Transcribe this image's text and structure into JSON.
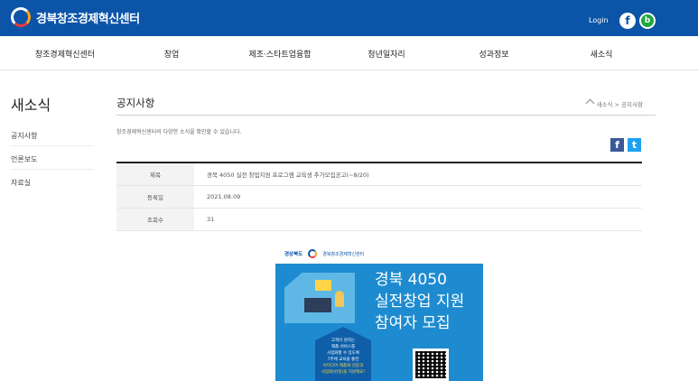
{
  "header": {
    "logo_text": "경북창조경제혁신센터",
    "login_label": "Login",
    "facebook_glyph": "f",
    "band_glyph": "b"
  },
  "nav": {
    "items": [
      {
        "label": "창조경제혁신센터"
      },
      {
        "label": "창업"
      },
      {
        "label": "제조·스타트업융합"
      },
      {
        "label": "청년일자리"
      },
      {
        "label": "성과정보"
      },
      {
        "label": "새소식"
      }
    ]
  },
  "sidebar": {
    "title": "새소식",
    "items": [
      {
        "label": "공지사항"
      },
      {
        "label": "언론보도"
      },
      {
        "label": "자료실"
      }
    ]
  },
  "main": {
    "title": "공지사항",
    "breadcrumb": "새소식 > 공지사항",
    "description": "창조경제혁신센터의 다양한 소식을 확인할 수 있습니다.",
    "share": {
      "facebook": "f",
      "twitter": "t"
    },
    "info": {
      "subject_key": "제목",
      "subject_value": "경북 4050 실전 창업지원 프로그램 교육생 추가모집공고(~8/20)",
      "date_key": "등록일",
      "date_value": "2021.08.09",
      "views_key": "조회수",
      "views_value": "31"
    },
    "poster": {
      "org1": "경상북도",
      "org2": "경북창조경제혁신센터",
      "line1": "경북 4050",
      "line2": "실전창업 지원",
      "line3": "참여자 모집",
      "center_text_1": "고객이 원하는",
      "center_text_2": "제품·서비스를",
      "center_text_3": "사업화할 수 있도록",
      "center_text_4": "7주에 교육을 통한",
      "center_text_5": "아이디어·제품화·검증과",
      "center_text_6": "사업화(런칭)을 지원해요!"
    }
  },
  "colors": {
    "brand_blue": "#0b54a8",
    "poster_blue": "#1e8bd0",
    "facebook": "#3b5998",
    "twitter": "#1da1f2"
  }
}
